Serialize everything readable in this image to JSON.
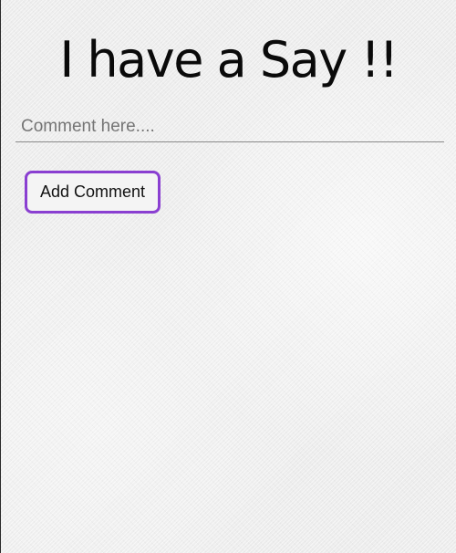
{
  "header": {
    "title": "I have a Say !!"
  },
  "comment_form": {
    "input_value": "",
    "input_placeholder": "Comment here....",
    "button_label": "Add Comment"
  },
  "colors": {
    "button_border": "#8a3fd1",
    "background": "#ececec",
    "title_text": "#0a0a0a"
  }
}
